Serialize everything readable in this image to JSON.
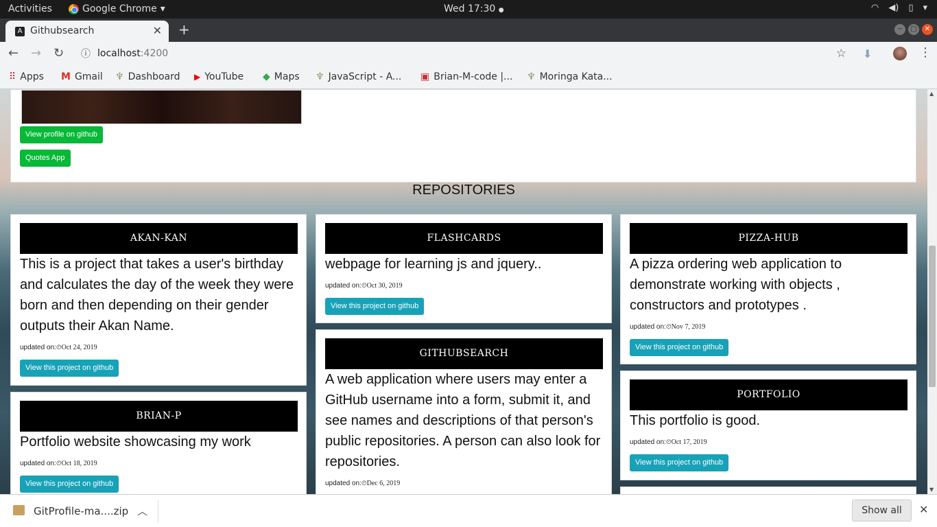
{
  "os_bar": {
    "activities": "Activities",
    "app_name": "Google Chrome",
    "app_caret": "▾",
    "clock": "Wed 17:30",
    "clock_dot": "●"
  },
  "browser": {
    "tab_title": "Githubsearch",
    "tab_favicon_letter": "A",
    "url_host": "localhost",
    "url_port": ":4200",
    "bookmarks": [
      {
        "label": "Apps",
        "icon": "apps-grid-icon"
      },
      {
        "label": "Gmail",
        "icon": "gmail-icon"
      },
      {
        "label": "Dashboard",
        "icon": "moringa-icon"
      },
      {
        "label": "YouTube",
        "icon": "youtube-icon"
      },
      {
        "label": "Maps",
        "icon": "maps-icon"
      },
      {
        "label": "JavaScript - A...",
        "icon": "moringa-icon"
      },
      {
        "label": "Brian-M-code |...",
        "icon": "codepen-icon"
      },
      {
        "label": "Moringa Kata...",
        "icon": "moringa-icon"
      }
    ]
  },
  "profile": {
    "view_github_label": "View profile on github",
    "quotes_app_label": "Quotes App"
  },
  "repositories_heading": "REPOSITORIES",
  "repo_common": {
    "updated_prefix": "updated on:",
    "clock_glyph": "⏲",
    "button_label": "View this project on github"
  },
  "repos": [
    {
      "name": "AKAN-KAN",
      "description": "This is a project that takes a user's birthday and calculates the day of the week they were born and then depending on their gender outputs their Akan Name.",
      "updated": "Oct 24, 2019"
    },
    {
      "name": "FLASHCARDS",
      "description": "webpage for learning js and jquery..",
      "updated": "Oct 30, 2019"
    },
    {
      "name": "PIZZA-HUB",
      "description": "A pizza ordering web application to demonstrate working with objects , constructors and prototypes .",
      "updated": "Nov 7, 2019"
    },
    {
      "name": "BRIAN-P",
      "description": "Portfolio website showcasing my work",
      "updated": "Oct 18, 2019"
    },
    {
      "name": "GITHUBSEARCH",
      "description": "A web application where users may enter a GitHub username into a form, submit it, and see names and descriptions of that person's public repositories. A person can also look for repositories.",
      "updated": "Dec 6, 2019"
    },
    {
      "name": "PORTFOLIO",
      "description": "This portfolio is good.",
      "updated": "Oct 17, 2019"
    }
  ],
  "downloads": {
    "file_name": "GitProfile-ma....zip",
    "show_all": "Show all"
  },
  "colors": {
    "github_button": "#08b838",
    "project_button": "#17a2b8",
    "repo_band": "#000000"
  }
}
